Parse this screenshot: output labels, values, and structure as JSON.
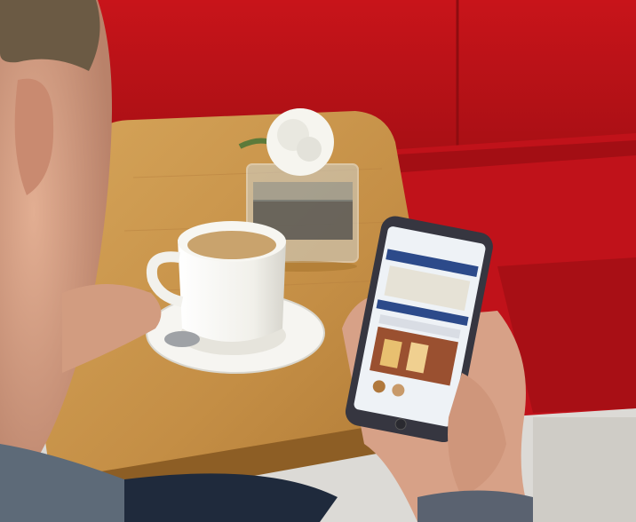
{
  "scene": {
    "colors": {
      "sofa": "#c8141a",
      "sofa_shadow": "#8f0c10",
      "table": "#c9974e",
      "table_dark": "#a8772f",
      "cup": "#f4f3ee",
      "coffee": "#c9a36d",
      "phone_case": "#3a3a44",
      "screen": "#eef2f6",
      "screen_header": "#2c4a8a",
      "skin": "#d9a58a",
      "hair": "#6b5a44"
    }
  }
}
